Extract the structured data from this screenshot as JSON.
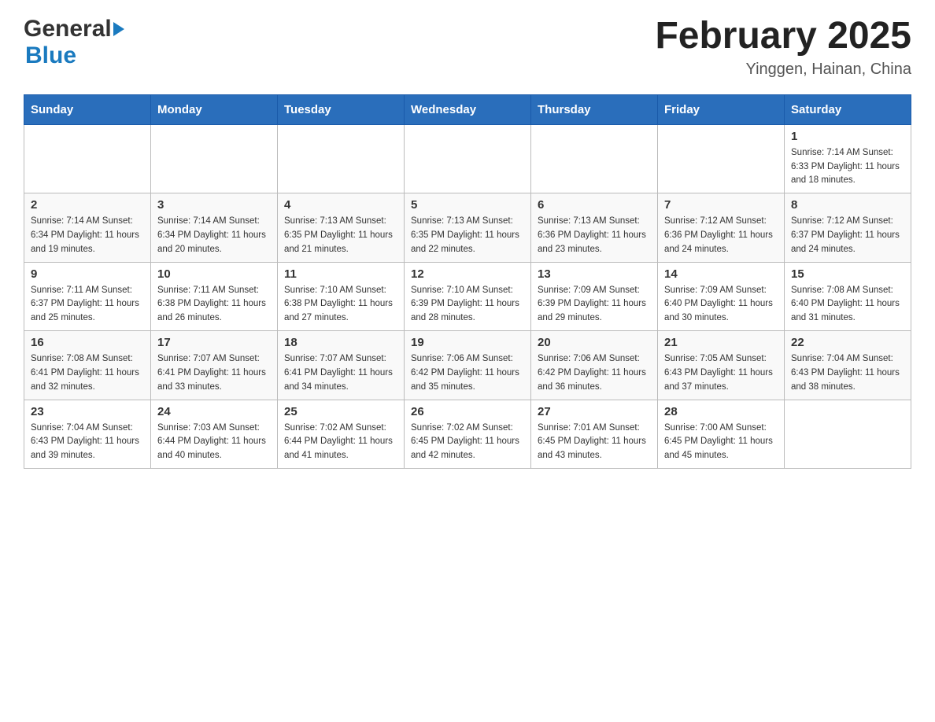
{
  "header": {
    "logo_general": "General",
    "logo_blue": "Blue",
    "month_title": "February 2025",
    "location": "Yinggen, Hainan, China"
  },
  "weekdays": [
    "Sunday",
    "Monday",
    "Tuesday",
    "Wednesday",
    "Thursday",
    "Friday",
    "Saturday"
  ],
  "weeks": [
    [
      {
        "day": "",
        "info": ""
      },
      {
        "day": "",
        "info": ""
      },
      {
        "day": "",
        "info": ""
      },
      {
        "day": "",
        "info": ""
      },
      {
        "day": "",
        "info": ""
      },
      {
        "day": "",
        "info": ""
      },
      {
        "day": "1",
        "info": "Sunrise: 7:14 AM\nSunset: 6:33 PM\nDaylight: 11 hours\nand 18 minutes."
      }
    ],
    [
      {
        "day": "2",
        "info": "Sunrise: 7:14 AM\nSunset: 6:34 PM\nDaylight: 11 hours\nand 19 minutes."
      },
      {
        "day": "3",
        "info": "Sunrise: 7:14 AM\nSunset: 6:34 PM\nDaylight: 11 hours\nand 20 minutes."
      },
      {
        "day": "4",
        "info": "Sunrise: 7:13 AM\nSunset: 6:35 PM\nDaylight: 11 hours\nand 21 minutes."
      },
      {
        "day": "5",
        "info": "Sunrise: 7:13 AM\nSunset: 6:35 PM\nDaylight: 11 hours\nand 22 minutes."
      },
      {
        "day": "6",
        "info": "Sunrise: 7:13 AM\nSunset: 6:36 PM\nDaylight: 11 hours\nand 23 minutes."
      },
      {
        "day": "7",
        "info": "Sunrise: 7:12 AM\nSunset: 6:36 PM\nDaylight: 11 hours\nand 24 minutes."
      },
      {
        "day": "8",
        "info": "Sunrise: 7:12 AM\nSunset: 6:37 PM\nDaylight: 11 hours\nand 24 minutes."
      }
    ],
    [
      {
        "day": "9",
        "info": "Sunrise: 7:11 AM\nSunset: 6:37 PM\nDaylight: 11 hours\nand 25 minutes."
      },
      {
        "day": "10",
        "info": "Sunrise: 7:11 AM\nSunset: 6:38 PM\nDaylight: 11 hours\nand 26 minutes."
      },
      {
        "day": "11",
        "info": "Sunrise: 7:10 AM\nSunset: 6:38 PM\nDaylight: 11 hours\nand 27 minutes."
      },
      {
        "day": "12",
        "info": "Sunrise: 7:10 AM\nSunset: 6:39 PM\nDaylight: 11 hours\nand 28 minutes."
      },
      {
        "day": "13",
        "info": "Sunrise: 7:09 AM\nSunset: 6:39 PM\nDaylight: 11 hours\nand 29 minutes."
      },
      {
        "day": "14",
        "info": "Sunrise: 7:09 AM\nSunset: 6:40 PM\nDaylight: 11 hours\nand 30 minutes."
      },
      {
        "day": "15",
        "info": "Sunrise: 7:08 AM\nSunset: 6:40 PM\nDaylight: 11 hours\nand 31 minutes."
      }
    ],
    [
      {
        "day": "16",
        "info": "Sunrise: 7:08 AM\nSunset: 6:41 PM\nDaylight: 11 hours\nand 32 minutes."
      },
      {
        "day": "17",
        "info": "Sunrise: 7:07 AM\nSunset: 6:41 PM\nDaylight: 11 hours\nand 33 minutes."
      },
      {
        "day": "18",
        "info": "Sunrise: 7:07 AM\nSunset: 6:41 PM\nDaylight: 11 hours\nand 34 minutes."
      },
      {
        "day": "19",
        "info": "Sunrise: 7:06 AM\nSunset: 6:42 PM\nDaylight: 11 hours\nand 35 minutes."
      },
      {
        "day": "20",
        "info": "Sunrise: 7:06 AM\nSunset: 6:42 PM\nDaylight: 11 hours\nand 36 minutes."
      },
      {
        "day": "21",
        "info": "Sunrise: 7:05 AM\nSunset: 6:43 PM\nDaylight: 11 hours\nand 37 minutes."
      },
      {
        "day": "22",
        "info": "Sunrise: 7:04 AM\nSunset: 6:43 PM\nDaylight: 11 hours\nand 38 minutes."
      }
    ],
    [
      {
        "day": "23",
        "info": "Sunrise: 7:04 AM\nSunset: 6:43 PM\nDaylight: 11 hours\nand 39 minutes."
      },
      {
        "day": "24",
        "info": "Sunrise: 7:03 AM\nSunset: 6:44 PM\nDaylight: 11 hours\nand 40 minutes."
      },
      {
        "day": "25",
        "info": "Sunrise: 7:02 AM\nSunset: 6:44 PM\nDaylight: 11 hours\nand 41 minutes."
      },
      {
        "day": "26",
        "info": "Sunrise: 7:02 AM\nSunset: 6:45 PM\nDaylight: 11 hours\nand 42 minutes."
      },
      {
        "day": "27",
        "info": "Sunrise: 7:01 AM\nSunset: 6:45 PM\nDaylight: 11 hours\nand 43 minutes."
      },
      {
        "day": "28",
        "info": "Sunrise: 7:00 AM\nSunset: 6:45 PM\nDaylight: 11 hours\nand 45 minutes."
      },
      {
        "day": "",
        "info": ""
      }
    ]
  ]
}
